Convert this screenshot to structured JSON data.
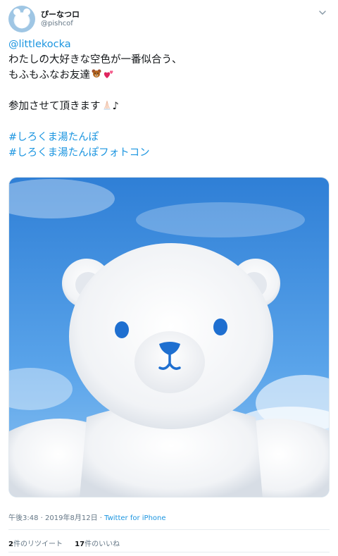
{
  "user": {
    "display_name": "ぴーなつロ",
    "handle": "@pishcof"
  },
  "tweet": {
    "mention": "@littlekocka",
    "line1": "わたしの大好きな空色が一番似合う、",
    "line2": "もふもふなお友達",
    "line3": "参加させて頂きます",
    "line3_suffix": "♪",
    "hashtag1": "#しろくま湯たんぽ",
    "hashtag2": "#しろくま湯たんぽフォトコン"
  },
  "meta": {
    "time": "午後3:48",
    "separator": "·",
    "date": "2019年8月12日",
    "source": "Twitter for iPhone"
  },
  "stats": {
    "retweet_count": "2",
    "retweet_label": "件のリツイート",
    "like_count": "17",
    "like_label": "件のいいね"
  },
  "icons": {
    "caret": "chevron-down-icon",
    "emoji1": "teddy-bear-emoji",
    "emoji2": "two-hearts-emoji",
    "emoji3": "folded-hands-emoji"
  },
  "colors": {
    "link": "#1b95e0",
    "secondary_text": "#657786",
    "divider": "#e6ecf0"
  }
}
